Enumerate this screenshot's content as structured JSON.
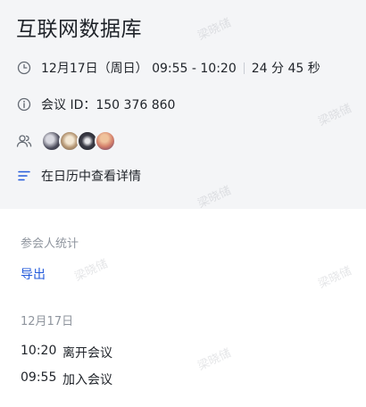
{
  "meeting": {
    "title": "互联网数据库",
    "time_range": "12月17日（周日） 09:55 - 10:20",
    "duration": "24 分 45 秒",
    "meeting_id": "会议 ID：150 376 860",
    "calendar_link": "在日历中查看详情",
    "participants": [
      {
        "icon": "avatar-1"
      },
      {
        "icon": "avatar-2"
      },
      {
        "icon": "avatar-3"
      },
      {
        "icon": "avatar-4"
      }
    ]
  },
  "stats": {
    "label": "参会人统计",
    "export_label": "导出",
    "date": "12月17日",
    "events": [
      {
        "time": "10:20",
        "action": "离开会议"
      },
      {
        "time": "09:55",
        "action": "加入会议"
      }
    ]
  },
  "watermark": "梁晓储",
  "colors": {
    "link": "#245bdb",
    "header_bg": "#f4f5f7",
    "muted": "#8f959e"
  }
}
